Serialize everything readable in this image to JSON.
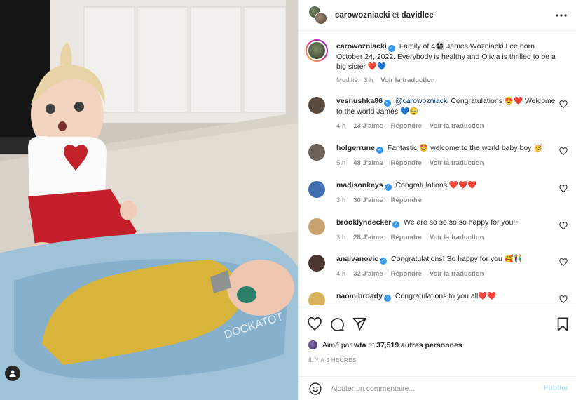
{
  "header": {
    "user1": "carowozniacki",
    "connector": "et",
    "user2": "davidlee"
  },
  "caption": {
    "user": "carowozniacki",
    "text": "Family of 4👨‍👩‍👧‍👦 James Wozniacki Lee born October 24, 2022. Everybody is healthy and Olivia is thrilled to be a big sister ❤️💙",
    "meta_time": "Modifié · 3 h",
    "translate": "Voir la traduction"
  },
  "comments": [
    {
      "user": "vesnushka86",
      "mention": "@carowozniacki",
      "text": "Congratulations 😍❤️ Welcome to the world James 💙🥹",
      "time": "4 h",
      "likes": "13 J'aime",
      "reply": "Répondre",
      "translate": "Voir la traduction",
      "avatar_color": "#5a4a3e"
    },
    {
      "user": "holgerrune",
      "mention": "",
      "text": "Fantastic 🤩 welcome to the world baby boy 🥳",
      "time": "5 h",
      "likes": "48 J'aime",
      "reply": "Répondre",
      "translate": "Voir la traduction",
      "avatar_color": "#6d625a"
    },
    {
      "user": "madisonkeys",
      "mention": "",
      "text": "Congratulations ❤️❤️❤️",
      "time": "3 h",
      "likes": "30 J'aime",
      "reply": "Répondre",
      "translate": "",
      "avatar_color": "#3f6fb0"
    },
    {
      "user": "brooklyndecker",
      "mention": "",
      "text": "We are so so so so happy for you!!",
      "time": "3 h",
      "likes": "28 J'aime",
      "reply": "Répondre",
      "translate": "Voir la traduction",
      "avatar_color": "#c9a36f"
    },
    {
      "user": "anaivanovic",
      "mention": "",
      "text": "Congratulations! So happy for you 🥰👫",
      "time": "4 h",
      "likes": "32 J'aime",
      "reply": "Répondre",
      "translate": "Voir la traduction",
      "avatar_color": "#4a3530"
    },
    {
      "user": "naomibroady",
      "mention": "",
      "text": "Congratulations to you all❤️❤️",
      "time": "",
      "likes": "",
      "reply": "",
      "translate": "",
      "avatar_color": "#d8b25c"
    }
  ],
  "likes": {
    "prefix": "Aimé par",
    "user": "wta",
    "connector": "et",
    "count": "37,519 autres personnes"
  },
  "time_ago": "IL Y A 5 HEURES",
  "add_comment": {
    "placeholder": "Ajouter un commentaire...",
    "post": "Publier"
  },
  "icons": {
    "heart": "heart-icon",
    "comment": "comment-icon",
    "share": "share-icon",
    "save": "bookmark-icon",
    "emoji": "emoji-icon",
    "more": "more-icon",
    "tag": "user-tag-icon",
    "verified": "verified-badge-icon"
  },
  "colors": {
    "verified": "#3897f0",
    "mention": "#00376b",
    "muted": "#8e8e8e",
    "post_disabled": "#b2dffc"
  }
}
